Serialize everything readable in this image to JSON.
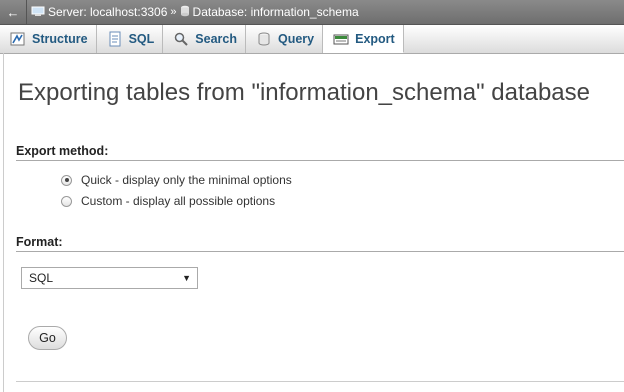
{
  "breadcrumb": {
    "back": "←",
    "server_label": "Server: localhost:3306",
    "separator": "»",
    "database_label": "Database: information_schema"
  },
  "tabs": [
    {
      "label": "Structure",
      "icon": "structure-icon",
      "active": false
    },
    {
      "label": "SQL",
      "icon": "sql-icon",
      "active": false
    },
    {
      "label": "Search",
      "icon": "search-icon",
      "active": false
    },
    {
      "label": "Query",
      "icon": "query-icon",
      "active": false
    },
    {
      "label": "Export",
      "icon": "export-icon",
      "active": true
    }
  ],
  "page": {
    "title": "Exporting tables from \"information_schema\" database"
  },
  "export_method": {
    "heading": "Export method:",
    "options": [
      {
        "label": "Quick - display only the minimal options",
        "checked": true
      },
      {
        "label": "Custom - display all possible options",
        "checked": false
      }
    ]
  },
  "format": {
    "heading": "Format:",
    "selected": "SQL"
  },
  "go_label": "Go",
  "colors": {
    "tab_text": "#235a81",
    "breadcrumb_bg": "#7b7b7b"
  }
}
